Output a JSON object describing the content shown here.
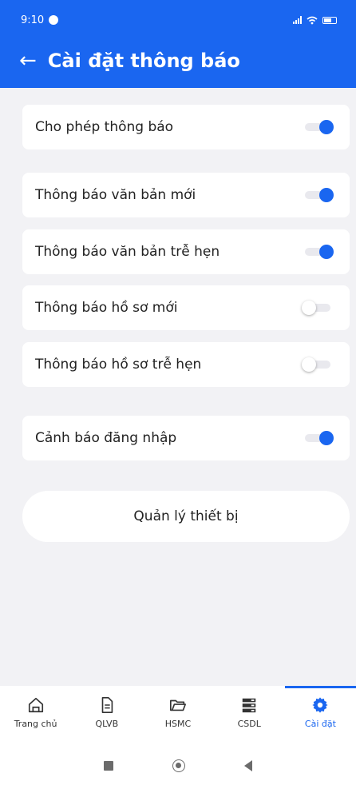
{
  "status_bar": {
    "time": "9:10"
  },
  "header": {
    "back_icon": "←",
    "title": "Cài đặt thông báo"
  },
  "settings": [
    {
      "label": "Cho phép thông báo",
      "enabled": true
    },
    {
      "label": "Thông báo văn bản mới",
      "enabled": true
    },
    {
      "label": "Thông báo văn bản trễ hẹn",
      "enabled": true
    },
    {
      "label": "Thông báo hồ sơ mới",
      "enabled": false
    },
    {
      "label": "Thông báo hồ sơ trễ hẹn",
      "enabled": false
    },
    {
      "label": "Cảnh báo đăng nhập",
      "enabled": true
    }
  ],
  "manage_button": {
    "label": "Quản lý thiết bị"
  },
  "bottom_nav": {
    "items": [
      {
        "label": "Trang chủ",
        "icon": "home-icon"
      },
      {
        "label": "QLVB",
        "icon": "document-icon"
      },
      {
        "label": "HSMC",
        "icon": "folder-icon"
      },
      {
        "label": "CSDL",
        "icon": "database-icon"
      },
      {
        "label": "Cài đặt",
        "icon": "gear-icon",
        "active": true
      }
    ]
  },
  "colors": {
    "accent": "#1a66f0",
    "background": "#f2f2f5",
    "card": "#ffffff"
  }
}
